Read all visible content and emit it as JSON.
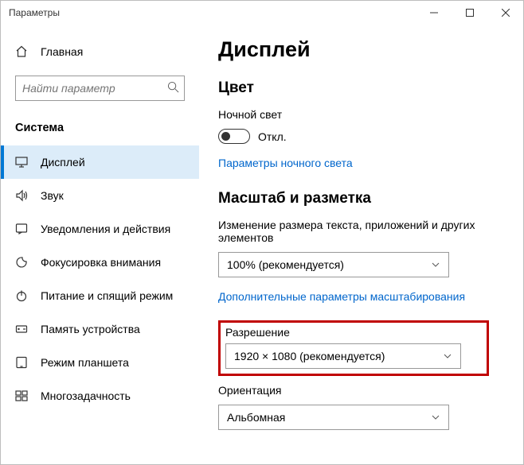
{
  "window": {
    "title": "Параметры"
  },
  "sidebar": {
    "home": "Главная",
    "search_placeholder": "Найти параметр",
    "section": "Система",
    "items": [
      {
        "label": "Дисплей"
      },
      {
        "label": "Звук"
      },
      {
        "label": "Уведомления и действия"
      },
      {
        "label": "Фокусировка внимания"
      },
      {
        "label": "Питание и спящий режим"
      },
      {
        "label": "Память устройства"
      },
      {
        "label": "Режим планшета"
      },
      {
        "label": "Многозадачность"
      }
    ]
  },
  "main": {
    "title": "Дисплей",
    "color_heading": "Цвет",
    "night_light_label": "Ночной свет",
    "night_light_state": "Откл.",
    "night_light_link": "Параметры ночного света",
    "scale_heading": "Масштаб и разметка",
    "scale_label": "Изменение размера текста, приложений и других элементов",
    "scale_value": "100% (рекомендуется)",
    "scale_link": "Дополнительные параметры масштабирования",
    "resolution_label": "Разрешение",
    "resolution_value": "1920 × 1080 (рекомендуется)",
    "orientation_label": "Ориентация",
    "orientation_value": "Альбомная"
  }
}
